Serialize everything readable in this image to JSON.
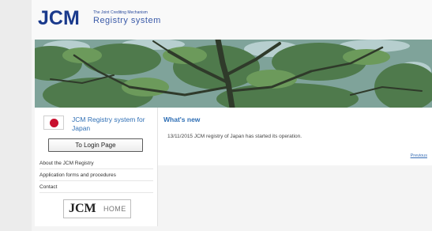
{
  "header": {
    "logo_main": "JCM",
    "logo_line1": "The Joint Crediting Mechanism",
    "logo_line2": "Registry system"
  },
  "sidebar": {
    "flag_icon": "japan-flag-icon",
    "registry_title": "JCM Registry system for Japan",
    "login_button": "To Login Page",
    "nav_items": [
      "About the JCM Registry",
      "Application forms and procedures",
      "Contact"
    ],
    "home_logo": "JCM",
    "home_label": "HOME"
  },
  "main": {
    "section_title": "What's new",
    "news": [
      "13/11/2015 JCM registry of Japan has started its operation."
    ],
    "previous_link": "Previous"
  },
  "colors": {
    "brand_blue": "#1a3a8c",
    "link_blue": "#2f6fb5",
    "flag_red": "#c8102e"
  }
}
